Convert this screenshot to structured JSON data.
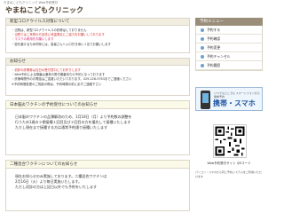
{
  "header": {
    "tagline": "やまねこどもクリニック Web予約受付",
    "title": "やまねこどもクリニック"
  },
  "covid": {
    "heading": "新型コロナウイルス対策について",
    "lines": [
      "・当院は、新型コロナウイルスの診療はしておりません",
      "・当院ではご来院の方全員に体温測定にご協力をお願いしております",
      "・マスクの着用をお願いします",
      "・密を避けるため同伴には、患者さんへ入口付き添い１名でお願いします"
    ]
  },
  "news": {
    "heading": "お知らせ",
    "lines": [
      "・初診の診察券は当日の受付窓口にてお作りします",
      "・Web予約による順番は通常の受付順番待ちの予約となっております",
      "・診療時間外のお電話はご遠慮いただいております。029-228-5763までご連絡ください",
      "※予約時間変更のご相談の際は、予約時間の前に必ずご連絡下さい"
    ]
  },
  "vaccine": {
    "title": "日本脳炎ワクチンの予約受付についてのお知らせ",
    "lines": [
      "日本脳炎ワクチンの品薄解消のため、1月18日（月）より予約数の調整を",
      "行うため1歳の２期接種１回目及び２回目の方を優先して接種いたします",
      "ただし現在まで接種する方は通常予約通り接種いたします"
    ]
  },
  "flu": {
    "title": "二種混合ワクチンについてのお知らせ",
    "lines": [
      "現在お知らせのみ実施しております。二種混合ワクチンは",
      "2月16日（火）より毎日実施いたします。",
      "ただし初診の方は上記日以外でも予約をいたします"
    ]
  },
  "sidebar": {
    "menu_title": "予約メニュー",
    "items": [
      {
        "label": "予約する"
      },
      {
        "label": "予約確認"
      },
      {
        "label": "予約変更"
      },
      {
        "label": "予約キャンセル"
      },
      {
        "label": "予約履歴"
      }
    ],
    "mobile_small": "いつでもどこでも スマートフォンから簡単予約",
    "mobile_big": "携帯・スマホ",
    "qr_caption": "Web予約受付サイト QRコード",
    "qr_sub": "パソコン・スマホから同じ予約システムをご利用いただけます"
  },
  "colors": {
    "accent": "#9a8e7a",
    "alert": "#d02b2b",
    "link": "#1d57b8"
  }
}
